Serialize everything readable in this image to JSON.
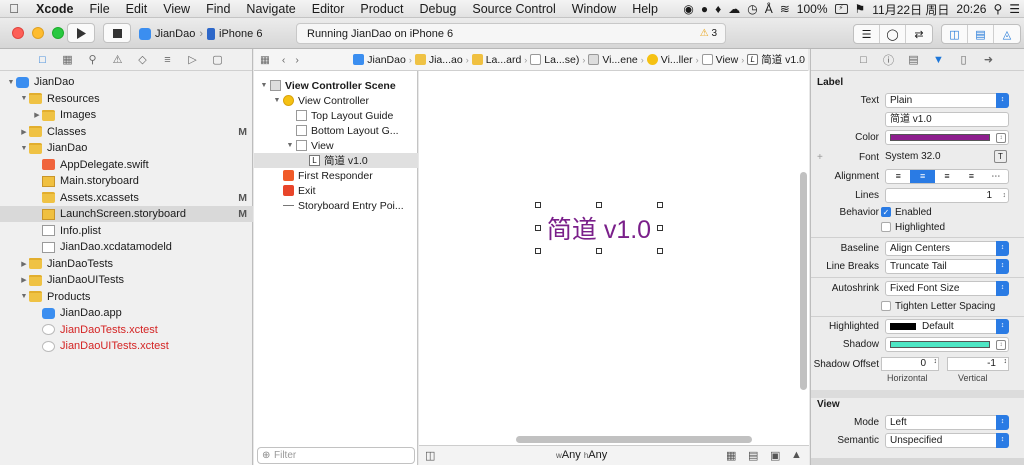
{
  "menubar": {
    "app": "Xcode",
    "items": [
      "File",
      "Edit",
      "View",
      "Find",
      "Navigate",
      "Editor",
      "Product",
      "Debug",
      "Source Control",
      "Window",
      "Help"
    ],
    "battery": "100%",
    "date": "11月22日 周日",
    "time": "20:26"
  },
  "toolbar": {
    "scheme_target": "JianDao",
    "scheme_device": "iPhone 6",
    "activity": "Running JianDao on iPhone 6",
    "warning_count": "3"
  },
  "navigator": {
    "rows": [
      {
        "label": "JianDao",
        "level": 0,
        "icon": "project-icon",
        "open": true,
        "badge": ""
      },
      {
        "label": "Resources",
        "level": 1,
        "icon": "folder-icon",
        "open": true,
        "badge": ""
      },
      {
        "label": "Images",
        "level": 2,
        "icon": "folder-icon",
        "open": false,
        "badge": ""
      },
      {
        "label": "Classes",
        "level": 1,
        "icon": "folder-icon",
        "open": false,
        "badge": "M"
      },
      {
        "label": "JianDao",
        "level": 1,
        "icon": "folder-icon",
        "open": true,
        "badge": ""
      },
      {
        "label": "AppDelegate.swift",
        "level": 2,
        "icon": "swift-file-icon",
        "badge": ""
      },
      {
        "label": "Main.storyboard",
        "level": 2,
        "icon": "storyboard-icon",
        "badge": ""
      },
      {
        "label": "Assets.xcassets",
        "level": 2,
        "icon": "assets-icon",
        "badge": "M"
      },
      {
        "label": "LaunchScreen.storyboard",
        "level": 2,
        "icon": "storyboard-icon",
        "badge": "M",
        "selected": true
      },
      {
        "label": "Info.plist",
        "level": 2,
        "icon": "plist-icon",
        "badge": ""
      },
      {
        "label": "JianDao.xcdatamodeld",
        "level": 2,
        "icon": "datamodel-icon",
        "badge": ""
      },
      {
        "label": "JianDaoTests",
        "level": 1,
        "icon": "folder-icon",
        "open": false,
        "badge": ""
      },
      {
        "label": "JianDaoUITests",
        "level": 1,
        "icon": "folder-icon",
        "open": false,
        "badge": ""
      },
      {
        "label": "Products",
        "level": 1,
        "icon": "folder-icon",
        "open": true,
        "badge": ""
      },
      {
        "label": "JianDao.app",
        "level": 2,
        "icon": "app-icon",
        "badge": ""
      },
      {
        "label": "JianDaoTests.xctest",
        "level": 2,
        "icon": "xctest-icon",
        "badge": "",
        "red": true
      },
      {
        "label": "JianDaoUITests.xctest",
        "level": 2,
        "icon": "xctest-icon",
        "badge": "",
        "red": true
      }
    ]
  },
  "jumpbar": [
    "JianDao",
    "Jia...ao",
    "La...ard",
    "La...se)",
    "Vi...ene",
    "Vi...ller",
    "View",
    "简道 v1.0"
  ],
  "outline": {
    "rows": [
      {
        "label": "View Controller Scene",
        "level": 0,
        "bold": true,
        "icon": "scene-icon",
        "open": true
      },
      {
        "label": "View Controller",
        "level": 1,
        "icon": "view-controller-icon",
        "open": true
      },
      {
        "label": "Top Layout Guide",
        "level": 2,
        "icon": "layout-guide-icon"
      },
      {
        "label": "Bottom Layout G...",
        "level": 2,
        "icon": "layout-guide-icon"
      },
      {
        "label": "View",
        "level": 2,
        "icon": "view-icon",
        "open": true
      },
      {
        "label": "简道 v1.0",
        "level": 3,
        "icon": "label-icon",
        "selected": true
      },
      {
        "label": "First Responder",
        "level": 1,
        "icon": "first-responder-icon"
      },
      {
        "label": "Exit",
        "level": 1,
        "icon": "exit-icon"
      },
      {
        "label": "Storyboard Entry Poi...",
        "level": 1,
        "icon": "entry-point-icon"
      }
    ],
    "filter_placeholder": "Filter"
  },
  "canvas": {
    "label_text": "简道 v1.0",
    "label_color": "#7a1f8a",
    "size_class_w": "Any",
    "size_class_h": "Any"
  },
  "inspector": {
    "section_label": "Label",
    "text_label": "Text",
    "text_value": "Plain",
    "text_content": "简道 v1.0",
    "color_label": "Color",
    "color_value": "#8e1f8e",
    "font_label": "Font",
    "font_value": "System 32.0",
    "alignment_label": "Alignment",
    "lines_label": "Lines",
    "lines_value": "1",
    "behavior_label": "Behavior",
    "enabled_label": "Enabled",
    "highlighted_cb_label": "Highlighted",
    "baseline_label": "Baseline",
    "baseline_value": "Align Centers",
    "linebreaks_label": "Line Breaks",
    "linebreaks_value": "Truncate Tail",
    "autoshrink_label": "Autoshrink",
    "autoshrink_value": "Fixed Font Size",
    "tighten_label": "Tighten Letter Spacing",
    "highlighted_label": "Highlighted",
    "highlighted_value": "Default",
    "highlighted_color": "#000000",
    "shadow_label": "Shadow",
    "shadow_color": "#4ee6c4",
    "shadow_offset_label": "Shadow Offset",
    "shadow_h": "0",
    "shadow_v": "-1",
    "horizontal_label": "Horizontal",
    "vertical_label": "Vertical",
    "view_section": "View",
    "mode_label": "Mode",
    "mode_value": "Left",
    "semantic_label": "Semantic",
    "semantic_value": "Unspecified"
  }
}
